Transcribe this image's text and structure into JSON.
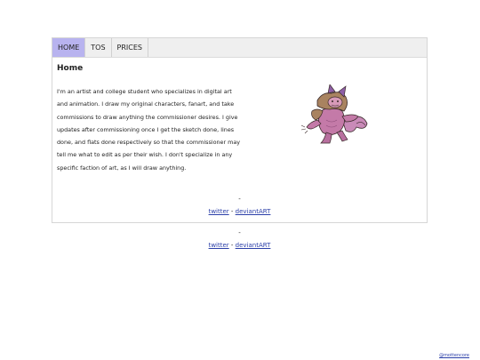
{
  "tabs": [
    {
      "label": "HOME"
    },
    {
      "label": "TOS"
    },
    {
      "label": "PRICES"
    }
  ],
  "home": {
    "heading": "Home",
    "body": "I'm an artist and college student who specializes in digital art and animation. I draw my original characters, fanart, and take commissions to draw anything the commissioner desires. I give updates after commissioning once I get the sketch done, lines done, and flats done respectively so that the commissioner may tell me what to edit as per their wish. I don't specialize in any specific faction of art, as I will draw anything."
  },
  "inner_footer": {
    "separator": "-",
    "twitter": "twitter",
    "link_sep": "-",
    "deviantart": "deviantART"
  },
  "outer_footer": {
    "separator": "-",
    "twitter": "twitter",
    "link_sep": "-",
    "deviantart": "deviantART"
  },
  "credit": "@mottencore",
  "colors": {
    "active_tab": "#b8b3ef",
    "link": "#2b3fa8"
  }
}
